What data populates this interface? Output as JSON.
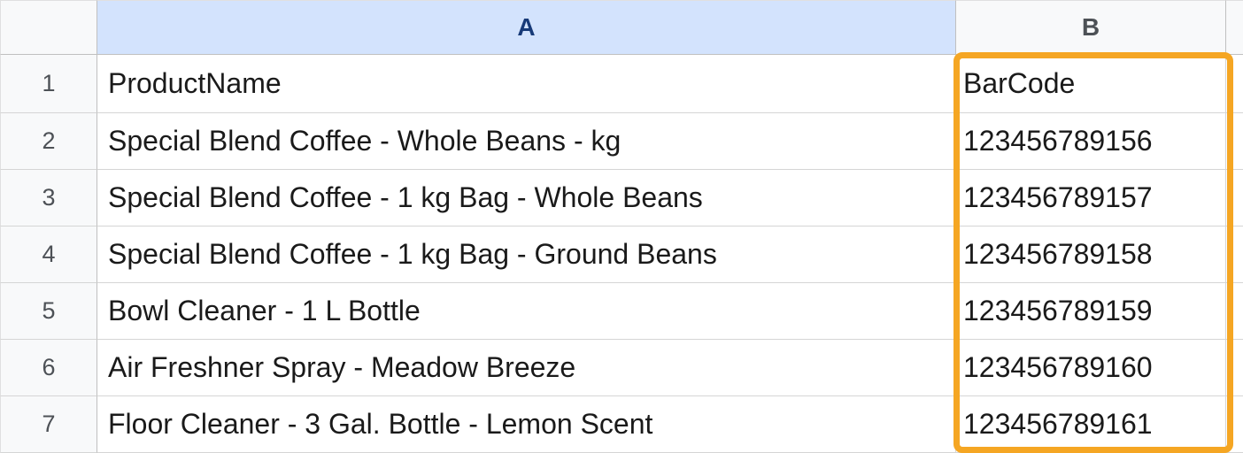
{
  "columns": {
    "a": "A",
    "b": "B"
  },
  "rowNumbers": [
    "1",
    "2",
    "3",
    "4",
    "5",
    "6",
    "7"
  ],
  "rows": [
    {
      "a": "ProductName",
      "b": "BarCode"
    },
    {
      "a": "Special Blend Coffee - Whole Beans - kg",
      "b": "123456789156"
    },
    {
      "a": "Special Blend Coffee - 1 kg Bag - Whole Beans",
      "b": "123456789157"
    },
    {
      "a": "Special Blend Coffee - 1 kg Bag - Ground Beans",
      "b": "123456789158"
    },
    {
      "a": "Bowl Cleaner - 1 L Bottle",
      "b": "123456789159"
    },
    {
      "a": "Air Freshner Spray - Meadow Breeze",
      "b": "123456789160"
    },
    {
      "a": "Floor Cleaner - 3 Gal. Bottle - Lemon Scent",
      "b": "123456789161"
    }
  ]
}
